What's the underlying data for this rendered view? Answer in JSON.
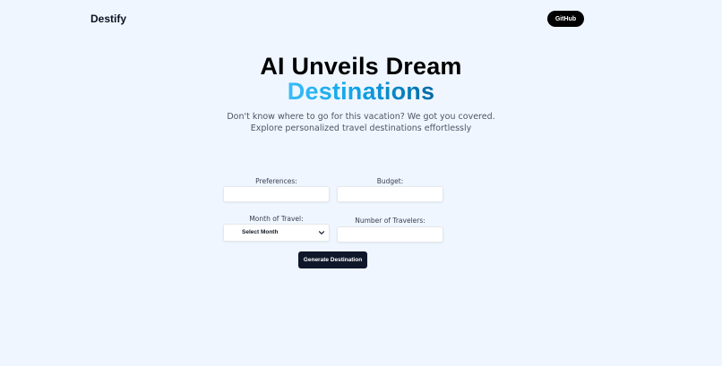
{
  "header": {
    "brand": "Destify",
    "github_label": "GitHub"
  },
  "hero": {
    "title_line1": "AI Unveils Dream",
    "title_line2": "Destinations",
    "subtitle_line1": "Don't know where to go for this vacation? We got you covered.",
    "subtitle_line2": "Explore personalized travel destinations effortlessly",
    "gradient_colors": [
      "#38bdf8",
      "#0ea5e9",
      "#0369a1"
    ]
  },
  "form": {
    "preferences": {
      "label": "Preferences:",
      "value": ""
    },
    "budget": {
      "label": "Budget:",
      "value": ""
    },
    "month": {
      "label": "Month of Travel:",
      "selected": "Select Month"
    },
    "travelers": {
      "label": "Number of Travelers:",
      "value": ""
    },
    "submit_label": "Generate Destination"
  },
  "icons": {
    "select_arrow": "chevron-down-icon"
  },
  "colors": {
    "background": "#eff6ff",
    "primary_button": "#0f172a",
    "github_button": "#000000"
  }
}
